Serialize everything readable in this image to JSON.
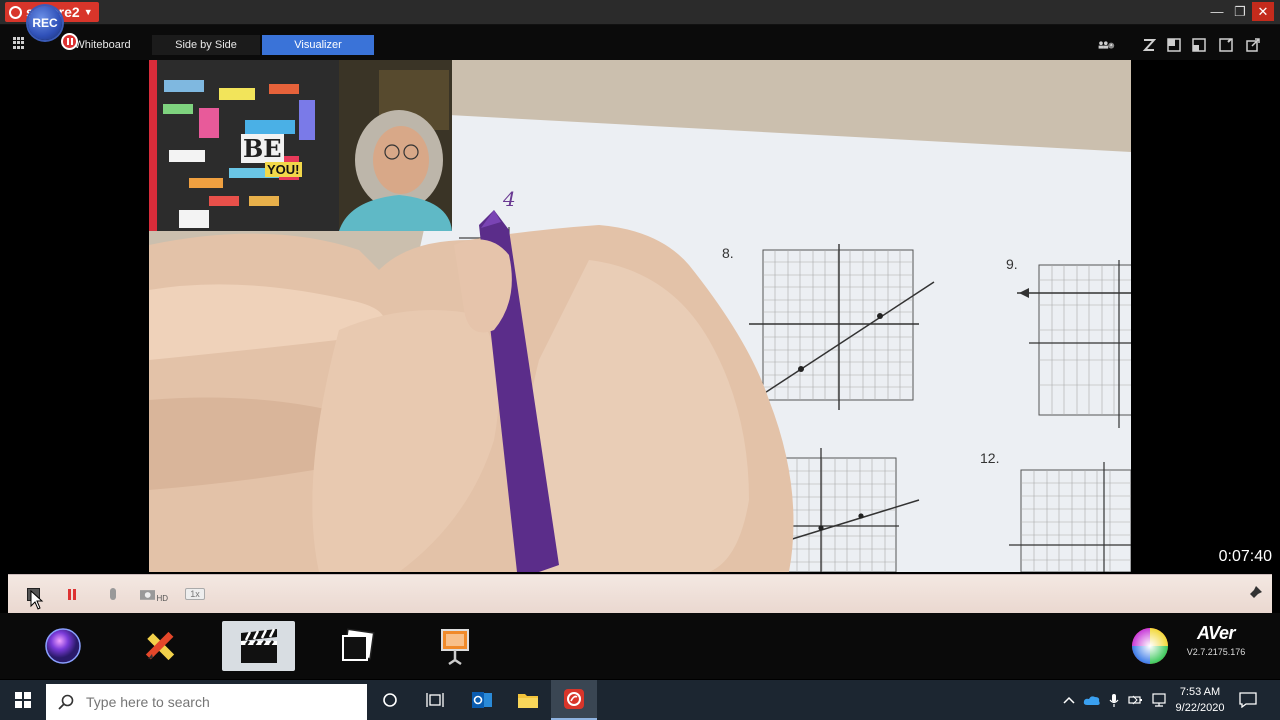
{
  "app": {
    "name": "sphere2",
    "window_controls": {
      "minimize": "—",
      "maximize": "❐",
      "close": "✕"
    }
  },
  "modebar": {
    "rec_label": "REC",
    "tabs": [
      {
        "label": "Whiteboard"
      },
      {
        "label": "Side by Side"
      },
      {
        "label": "Visualizer",
        "active": true
      }
    ],
    "tool_icons": [
      "group-icon",
      "brush-icon",
      "window-icon",
      "split-icon",
      "settings-icon",
      "external-icon"
    ]
  },
  "video": {
    "elapsed": "0:07:40",
    "worksheet_labels": {
      "problem_a": "4",
      "problem_b": "8.",
      "problem_c": "9.",
      "problem_d": "12."
    },
    "poster_word_be": "BE",
    "poster_word_you": "YOU!"
  },
  "controls": {
    "hd_label": "HD",
    "speed_label": "1x"
  },
  "dock": {
    "items": [
      "color-wheel",
      "annotate-tools",
      "visualizer",
      "capture",
      "presentation"
    ],
    "brand": "AVer",
    "version": "V2.7.2175.176"
  },
  "taskbar": {
    "search_placeholder": "Type here to search",
    "time": "7:53 AM",
    "date": "9/22/2020"
  },
  "colors": {
    "accent_tab": "#3a73d8",
    "rec": "#2f50b8",
    "brand": "#d8352a",
    "taskbar": "#1c2631"
  }
}
